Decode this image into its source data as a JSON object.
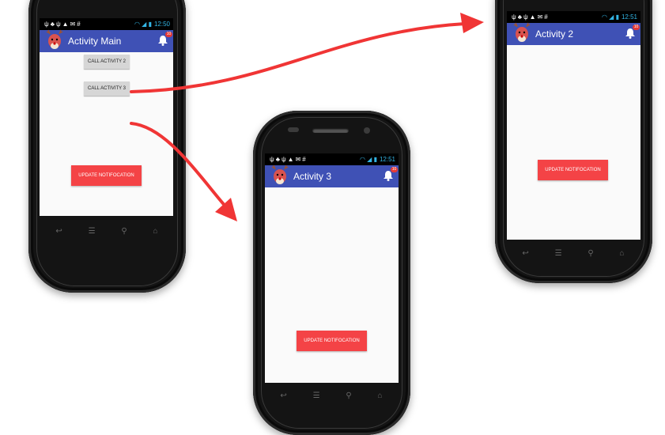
{
  "colors": {
    "appbar": "#3f51b5",
    "primary_button": "#f44346",
    "arrow": "#f03535",
    "badge": "#e53935"
  },
  "icons": {
    "status_left": [
      "usb-icon",
      "android-debug-icon",
      "usb-icon",
      "warning-icon",
      "email-icon",
      "grid-icon"
    ],
    "status_right": [
      "wifi-icon",
      "signal-icon",
      "battery-icon"
    ],
    "nav": [
      "back-icon",
      "menu-icon",
      "search-icon",
      "home-icon"
    ],
    "appbar": [
      "reindeer-logo-icon",
      "notification-bell-icon"
    ]
  },
  "phones": {
    "main": {
      "time": "12:50",
      "title": "Activity Main",
      "badge": "10",
      "call2_label": "CALL ACTIVITY 2",
      "call3_label": "CALL ACTIVITY 3",
      "update_label": "UPDATE NOTIFOCATION"
    },
    "activity3": {
      "time": "12:51",
      "title": "Activity 3",
      "badge": "10",
      "update_label": "UPDATE NOTIFOCATION"
    },
    "activity2": {
      "time": "12:51",
      "title": "Activity 2",
      "badge": "10",
      "update_label": "UPDATE NOTIFOCATION"
    }
  }
}
